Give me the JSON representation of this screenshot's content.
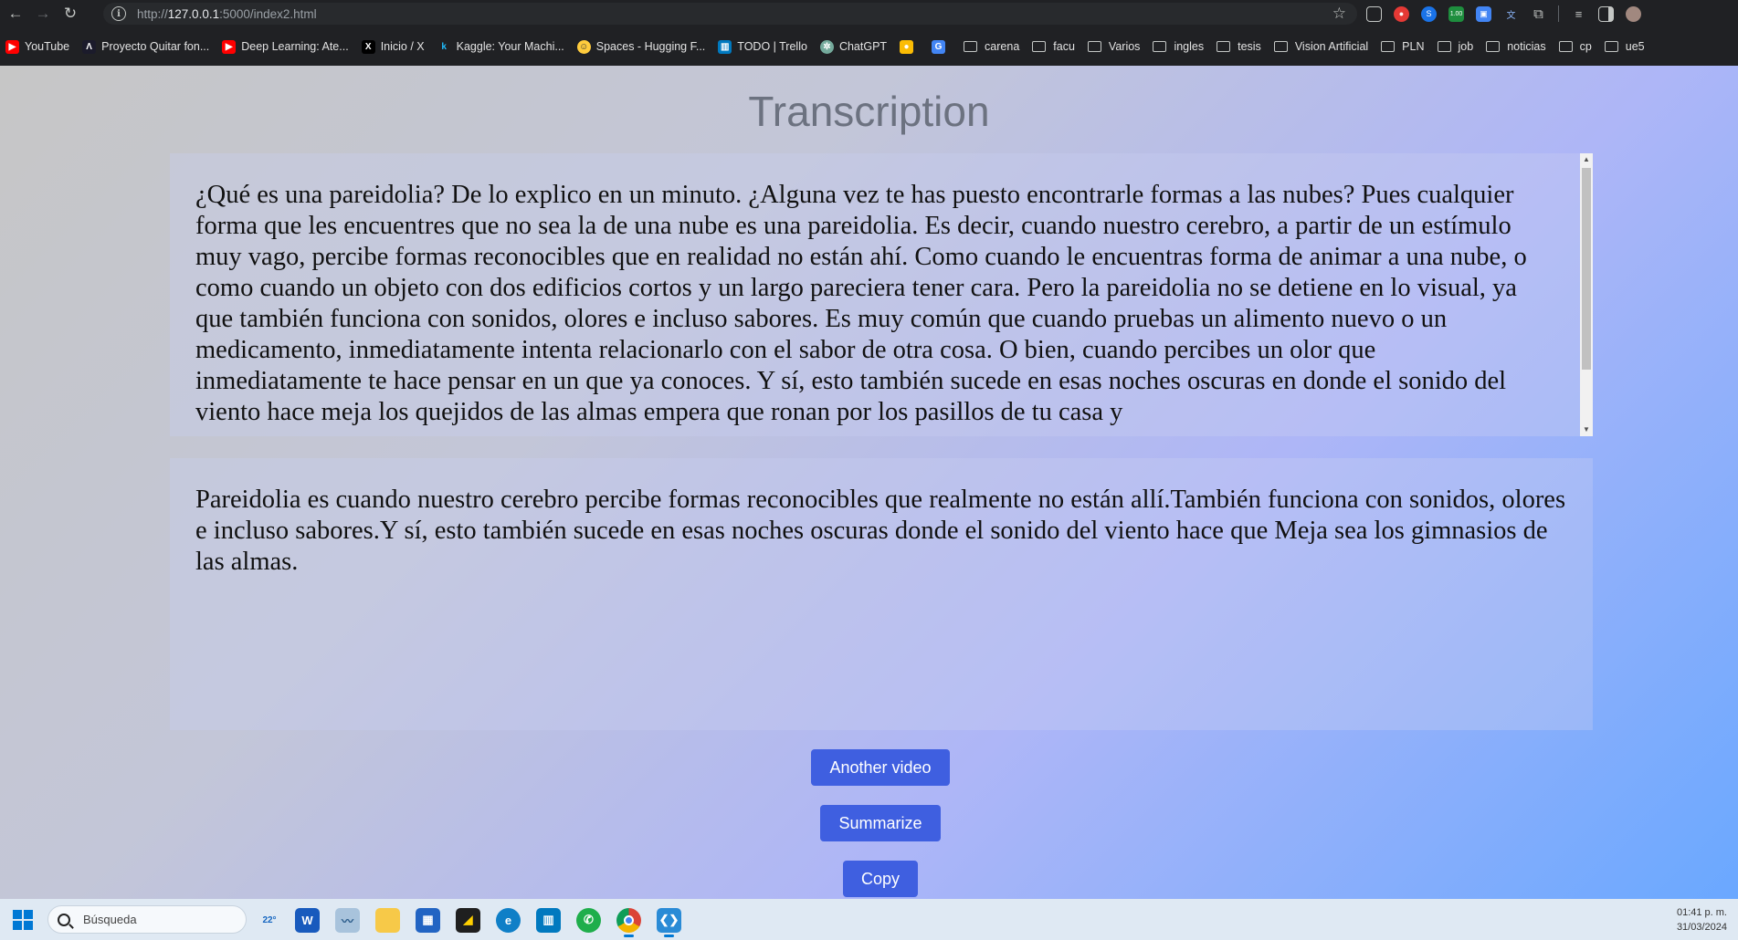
{
  "browser": {
    "url_prefix": "http://",
    "url_host": "127.0.0.1",
    "url_rest": ":5000/index2.html"
  },
  "bookmarks": [
    {
      "label": "YouTube",
      "icon": "youtube-icon",
      "color": "#ff0000"
    },
    {
      "label": "Proyecto Quitar fon...",
      "icon": "project-icon",
      "color": "#1b1b2b"
    },
    {
      "label": "Deep Learning: Ate...",
      "icon": "youtube-icon",
      "color": "#ff0000"
    },
    {
      "label": "Inicio / X",
      "icon": "x-icon",
      "color": "#000000"
    },
    {
      "label": "Kaggle: Your Machi...",
      "icon": "kaggle-icon",
      "color": "#20beff"
    },
    {
      "label": "Spaces - Hugging F...",
      "icon": "huggingface-icon",
      "color": "#ffcc3d"
    },
    {
      "label": "TODO | Trello",
      "icon": "trello-icon",
      "color": "#0079bf"
    },
    {
      "label": "ChatGPT",
      "icon": "chatgpt-icon",
      "color": "#74aa9c"
    },
    {
      "label": "",
      "icon": "keep-icon",
      "color": "#fbbc04"
    },
    {
      "label": "",
      "icon": "translate-icon",
      "color": "#4285f4"
    },
    {
      "label": "carena",
      "icon": "folder-icon"
    },
    {
      "label": "facu",
      "icon": "folder-icon"
    },
    {
      "label": "Varios",
      "icon": "folder-icon"
    },
    {
      "label": "ingles",
      "icon": "folder-icon"
    },
    {
      "label": "tesis",
      "icon": "folder-icon"
    },
    {
      "label": "Vision Artificial",
      "icon": "folder-icon"
    },
    {
      "label": "PLN",
      "icon": "folder-icon"
    },
    {
      "label": "job",
      "icon": "folder-icon"
    },
    {
      "label": "noticias",
      "icon": "folder-icon"
    },
    {
      "label": "cp",
      "icon": "folder-icon"
    },
    {
      "label": "ue5",
      "icon": "folder-icon"
    }
  ],
  "page": {
    "title": "Transcription",
    "transcript": "¿Qué es una pareidolia? De lo explico en un minuto. ¿Alguna vez te has puesto encontrarle formas a las nubes? Pues cualquier forma que les encuentres que no sea la de una nube es una pareidolia. Es decir, cuando nuestro cerebro, a partir de un estímulo muy vago, percibe formas reconocibles que en realidad no están ahí. Como cuando le encuentras forma de animar a una nube, o como cuando un objeto con dos edificios cortos y un largo pareciera tener cara. Pero la pareidolia no se detiene en lo visual, ya que también funciona con sonidos, olores e incluso sabores. Es muy común que cuando pruebas un alimento nuevo o un medicamento, inmediatamente intenta relacionarlo con el sabor de otra cosa. O bien, cuando percibes un olor que inmediatamente te hace pensar en un que ya conoces. Y sí, esto también sucede en esas noches oscuras en donde el sonido del viento hace meja los quejidos de las almas empera que ronan por los pasillos de tu casa y",
    "summary": "Pareidolia es cuando nuestro cerebro percibe formas reconocibles que realmente no están allí.También funciona con sonidos, olores e incluso sabores.Y sí, esto también sucede en esas noches oscuras donde el sonido del viento hace que Meja sea los gimnasios de las almas.",
    "buttons": {
      "another_video": "Another video",
      "summarize": "Summarize",
      "copy": "Copy"
    }
  },
  "taskbar": {
    "search_placeholder": "Búsqueda",
    "weather": "22°",
    "time": "01:41 p. m.",
    "date": "31/03/2024"
  }
}
